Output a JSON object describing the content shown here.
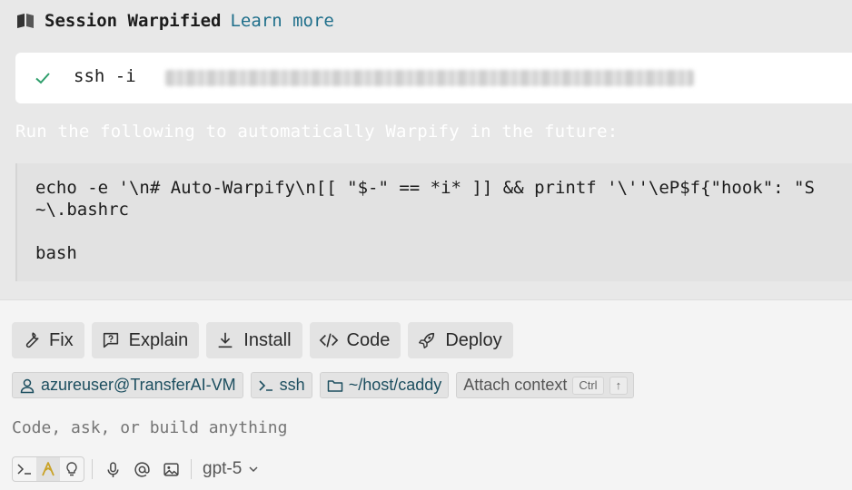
{
  "session": {
    "title": "Session Warpified",
    "link": "Learn more",
    "ssh_command": "ssh -i"
  },
  "hint": "Run the following to automatically Warpify in the future:",
  "code": {
    "line1": "echo -e '\\n# Auto-Warpify\\n[[ \"$-\" == *i* ]] && printf '\\''\\eP$f{\"hook\": \"S",
    "line2": "~\\.bashrc",
    "line3": "bash"
  },
  "actions": [
    {
      "label": "Fix",
      "icon": "wrench-icon"
    },
    {
      "label": "Explain",
      "icon": "question-bubble-icon"
    },
    {
      "label": "Install",
      "icon": "download-icon"
    },
    {
      "label": "Code",
      "icon": "code-icon"
    },
    {
      "label": "Deploy",
      "icon": "rocket-icon"
    }
  ],
  "context": {
    "user": "azureuser@TransferAI-VM",
    "shell": "ssh",
    "path": "~/host/caddy",
    "attach": "Attach context",
    "kbd1": "Ctrl",
    "kbd2": "↑"
  },
  "prompt": {
    "placeholder": "Code, ask, or build anything"
  },
  "toolbar": {
    "model": "gpt-5"
  },
  "colors": {
    "link": "#1f6f8b",
    "check": "#2e9e6b",
    "chip_text": "#1c4e5f",
    "agent_accent": "#c9a227"
  }
}
